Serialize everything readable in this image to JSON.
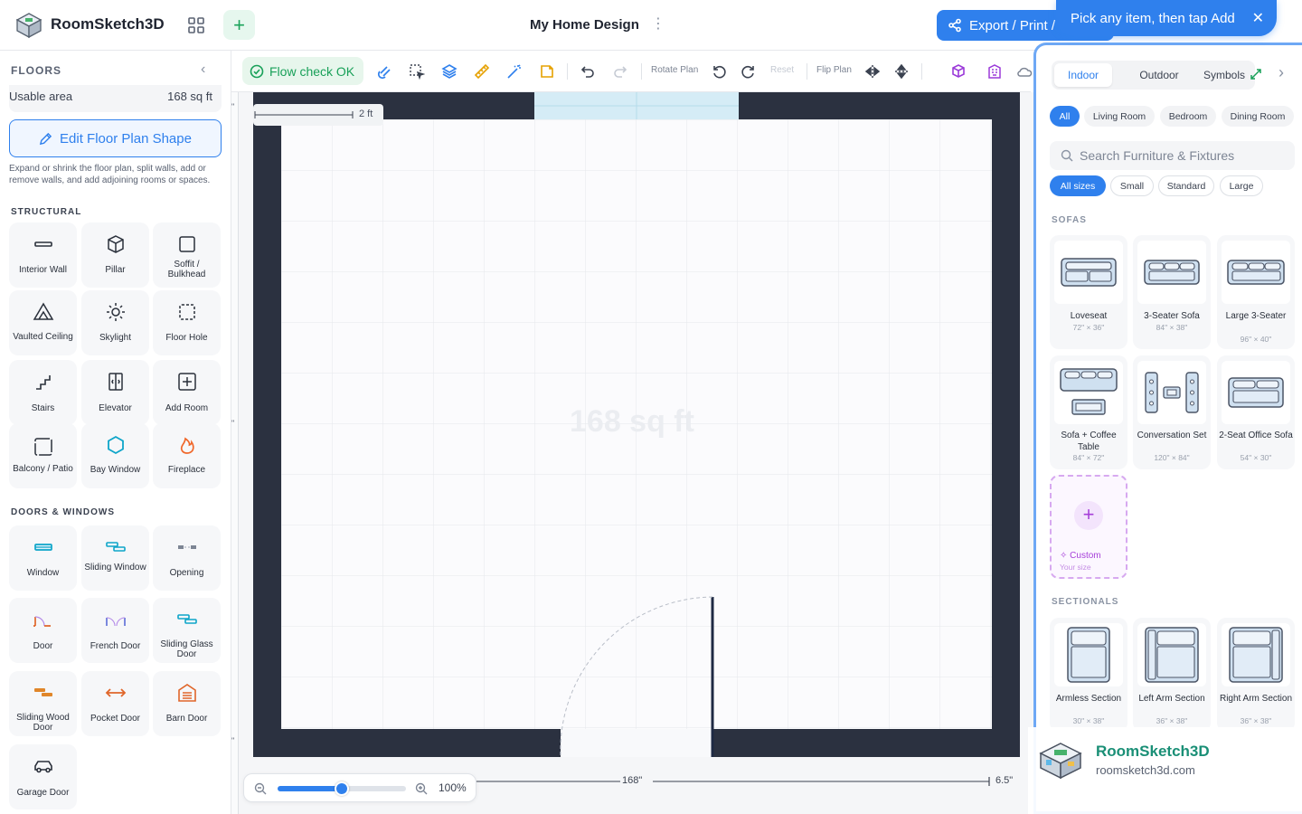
{
  "header": {
    "app_name": "RoomSketch3D",
    "doc_title": "My Home Design",
    "export_label": "Export / Print /",
    "toast": "Pick any item, then tap Add"
  },
  "left": {
    "floors_label": "FLOORS",
    "usable_label": "Usable area",
    "usable_value": "168 sq ft",
    "edit_shape_label": "Edit Floor Plan Shape",
    "edit_help": "Expand or shrink the floor plan, split walls, add or remove walls, and add adjoining rooms or spaces.",
    "structural_label": "STRUCTURAL",
    "structural": [
      "Interior Wall",
      "Pillar",
      "Soffit / Bulkhead",
      "Vaulted Ceiling",
      "Skylight",
      "Floor Hole",
      "Stairs",
      "Elevator",
      "Add Room",
      "Balcony / Patio",
      "Bay Window",
      "Fireplace"
    ],
    "doors_label": "DOORS & WINDOWS",
    "doors": [
      "Window",
      "Sliding Window",
      "Opening",
      "Door",
      "French Door",
      "Sliding Glass Door",
      "Sliding Wood Door",
      "Pocket Door",
      "Barn Door",
      "Garage Door"
    ]
  },
  "toolbar": {
    "flow_check": "Flow check OK",
    "rotate_plan": "Rotate Plan",
    "reset": "Reset",
    "flip_plan": "Flip Plan"
  },
  "canvas": {
    "scale_label": "2 ft",
    "area_watermark": "168 sq ft",
    "dim_bottom": "168\"",
    "dim_right": "6.5\"",
    "zoom_value": "100%",
    "zoom_level": 0.5
  },
  "right": {
    "tabs": [
      "Indoor",
      "Outdoor",
      "Symbols"
    ],
    "rooms": [
      "All",
      "Living Room",
      "Bedroom",
      "Dining Room"
    ],
    "search_placeholder": "Search Furniture & Fixtures",
    "sizes": [
      "All sizes",
      "Small",
      "Standard",
      "Large"
    ],
    "sofas_label": "SOFAS",
    "sofas": [
      {
        "name": "Loveseat",
        "dims": "72\" × 36\""
      },
      {
        "name": "3-Seater Sofa",
        "dims": "84\" × 38\""
      },
      {
        "name": "Large 3-Seater",
        "dims": "96\" × 40\""
      },
      {
        "name": "Sofa + Coffee Table",
        "dims": "84\" × 72\""
      },
      {
        "name": "Conversation Set",
        "dims": "120\" × 84\""
      },
      {
        "name": "2-Seat Office Sofa",
        "dims": "54\" × 30\""
      }
    ],
    "custom_label": "Custom",
    "custom_sub": "Your size",
    "sectionals_label": "SECTIONALS",
    "sectionals": [
      {
        "name": "Armless Section",
        "dims": "30\" × 38\""
      },
      {
        "name": "Left Arm Section",
        "dims": "36\" × 38\""
      },
      {
        "name": "Right Arm Section",
        "dims": "36\" × 38\""
      }
    ]
  },
  "brand": {
    "name": "RoomSketch3D",
    "url": "roomsketch3d.com"
  },
  "colors": {
    "accent": "#2f80ed",
    "wall": "#2b3140",
    "success": "#18a058"
  }
}
